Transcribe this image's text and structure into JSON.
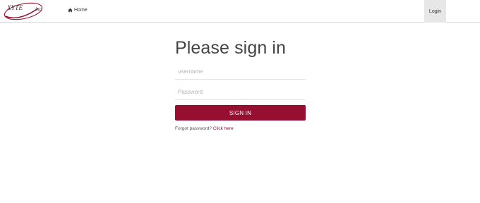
{
  "brand": {
    "logo_text": "XYTE",
    "logo_suffix": "inc.",
    "accent_color": "#970f30"
  },
  "nav": {
    "home_icon": "home-icon",
    "home_label": "Home",
    "login_label": "Login"
  },
  "signin": {
    "title": "Please sign in",
    "username_placeholder": "username",
    "username_value": "",
    "password_placeholder": "Password",
    "password_value": "",
    "button_label": "SIGN IN",
    "forgot_text": "Forgot password?",
    "forgot_link": "Click here"
  }
}
